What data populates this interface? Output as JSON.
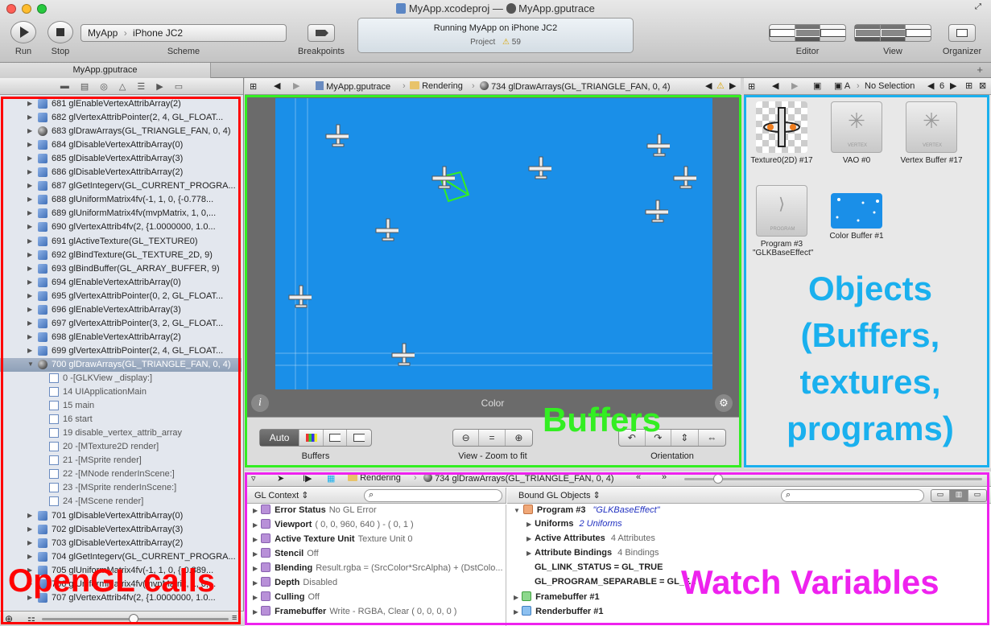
{
  "window": {
    "title_project": "MyApp.xcodeproj",
    "title_sep": "—",
    "title_trace": "MyApp.gputrace"
  },
  "toolbar": {
    "run_label": "Run",
    "stop_label": "Stop",
    "scheme_target": "MyApp",
    "scheme_device": "iPhone JC2",
    "scheme_label": "Scheme",
    "breakpoints_label": "Breakpoints",
    "activity_status": "Running MyApp on iPhone JC2",
    "activity_project_label": "Project",
    "activity_warnings": "59",
    "editor_label": "Editor",
    "view_label": "View",
    "organizer_label": "Organizer"
  },
  "tab": {
    "label": "MyApp.gputrace"
  },
  "navigator": {
    "calls": [
      {
        "label": "681 glEnableVertexAttribArray(2)",
        "icon": "cube"
      },
      {
        "label": "682 glVertexAttribPointer(2, 4, GL_FLOAT...",
        "icon": "cube"
      },
      {
        "label": "683 glDrawArrays(GL_TRIANGLE_FAN, 0, 4)",
        "icon": "ball"
      },
      {
        "label": "684 glDisableVertexAttribArray(0)",
        "icon": "cube"
      },
      {
        "label": "685 glDisableVertexAttribArray(3)",
        "icon": "cube"
      },
      {
        "label": "686 glDisableVertexAttribArray(2)",
        "icon": "cube"
      },
      {
        "label": "687 glGetIntegerv(GL_CURRENT_PROGRA...",
        "icon": "cube"
      },
      {
        "label": "688 glUniformMatrix4fv(-1, 1, 0, {-0.778...",
        "icon": "cube"
      },
      {
        "label": "689 glUniformMatrix4fv(mvpMatrix, 1, 0,...",
        "icon": "cube"
      },
      {
        "label": "690 glVertexAttrib4fv(2, {1.0000000, 1.0...",
        "icon": "cube"
      },
      {
        "label": "691 glActiveTexture(GL_TEXTURE0)",
        "icon": "cube"
      },
      {
        "label": "692 glBindTexture(GL_TEXTURE_2D, 9)",
        "icon": "cube"
      },
      {
        "label": "693 glBindBuffer(GL_ARRAY_BUFFER, 9)",
        "icon": "cube"
      },
      {
        "label": "694 glEnableVertexAttribArray(0)",
        "icon": "cube"
      },
      {
        "label": "695 glVertexAttribPointer(0, 2, GL_FLOAT...",
        "icon": "cube"
      },
      {
        "label": "696 glEnableVertexAttribArray(3)",
        "icon": "cube"
      },
      {
        "label": "697 glVertexAttribPointer(3, 2, GL_FLOAT...",
        "icon": "cube"
      },
      {
        "label": "698 glEnableVertexAttribArray(2)",
        "icon": "cube"
      },
      {
        "label": "699 glVertexAttribPointer(2, 4, GL_FLOAT...",
        "icon": "cube"
      }
    ],
    "selected_call": "700 glDrawArrays(GL_TRIANGLE_FAN, 0, 4)",
    "stack": [
      "0 -[GLKView _display:]",
      "14 UIApplicationMain",
      "15 main",
      "16 start",
      "19 disable_vertex_attrib_array",
      "20 -[MTexture2D render]",
      "21 -[MSprite render]",
      "22 -[MNode renderInScene:]",
      "23 -[MSprite renderInScene:]",
      "24 -[MScene render]"
    ],
    "calls_after": [
      "701 glDisableVertexAttribArray(0)",
      "702 glDisableVertexAttribArray(3)",
      "703 glDisableVertexAttribArray(2)",
      "704 glGetIntegerv(GL_CURRENT_PROGRA...",
      "705 glUniformMatrix4fv(-1, 1, 0, {-0.389...",
      "706 glUniformMatrix4fv(mvpMatrix, 1, 0,...",
      "707 glVertexAttrib4fv(2, {1.0000000, 1.0..."
    ]
  },
  "editor_jumpbar": {
    "trace": "MyApp.gputrace",
    "group": "Rendering",
    "call": "734 glDrawArrays(GL_TRIANGLE_FAN, 0, 4)"
  },
  "objects_jumpbar": {
    "selection": "No Selection",
    "count": "6"
  },
  "editor": {
    "canvas_label": "Color",
    "auto_label": "Auto",
    "buffers_label": "Buffers",
    "zoom_label": "View - Zoom to fit",
    "orientation_label": "Orientation"
  },
  "objects": [
    {
      "label": "Texture0(2D) #17"
    },
    {
      "label": "VAO #0",
      "thumb_text": "VERTEX"
    },
    {
      "label": "Vertex Buffer #17",
      "thumb_text": "VERTEX"
    },
    {
      "label": "Program #3 \"GLKBaseEffect\"",
      "thumb_text": "PROGRAM"
    },
    {
      "label": "Color Buffer #1"
    }
  ],
  "debug_jumpbar": {
    "group": "Rendering",
    "call": "734 glDrawArrays(GL_TRIANGLE_FAN, 0, 4)"
  },
  "gl_context": {
    "header": "GL Context",
    "rows": [
      {
        "name": "Error Status",
        "value": "No GL Error"
      },
      {
        "name": "Viewport",
        "value": "( 0, 0, 960, 640 ) - ( 0, 1 )"
      },
      {
        "name": "Active Texture Unit",
        "value": "Texture Unit 0"
      },
      {
        "name": "Stencil",
        "value": "Off"
      },
      {
        "name": "Blending",
        "value": "Result.rgba = (SrcColor*SrcAlpha) + (DstColo..."
      },
      {
        "name": "Depth",
        "value": "Disabled"
      },
      {
        "name": "Culling",
        "value": "Off"
      },
      {
        "name": "Framebuffer",
        "value": "Write - RGBA, Clear ( 0, 0, 0, 0 )"
      }
    ]
  },
  "bound_objects": {
    "header": "Bound GL Objects",
    "program_name": "Program #3",
    "program_value": "\"GLKBaseEffect\"",
    "uniforms_label": "Uniforms",
    "uniforms_value": "2 Uniforms",
    "attributes_label": "Active Attributes",
    "attributes_value": "4 Attributes",
    "bindings_label": "Attribute Bindings",
    "bindings_value": "4 Bindings",
    "link_status": "GL_LINK_STATUS = GL_TRUE",
    "separable": "GL_PROGRAM_SEPARABLE = GL_F...",
    "framebuffer": "Framebuffer #1",
    "renderbuffer": "Renderbuffer #1"
  },
  "annotations": {
    "opengl_calls": "OpenGL calls",
    "buffers": "Buffers",
    "objects": "Objects (Buffers, textures, programs)",
    "objects_lines": [
      "Objects",
      "(Buffers,",
      "textures,",
      "programs)"
    ],
    "watch_variables": "Watch Variables"
  },
  "colors": {
    "opengl_calls_red": "#ff0000",
    "buffers_green": "#33ee22",
    "objects_blue": "#1ab0ee",
    "watch_magenta": "#ee22ee",
    "canvas_blue": "#1a8fe8"
  }
}
